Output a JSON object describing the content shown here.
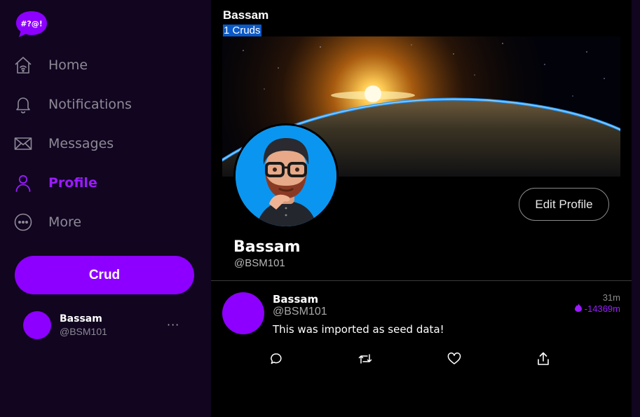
{
  "app": {
    "logo_text": "#?@!",
    "accent": "#8d00ff"
  },
  "sidebar": {
    "items": [
      {
        "label": "Home",
        "icon": "home-icon"
      },
      {
        "label": "Notifications",
        "icon": "bell-icon"
      },
      {
        "label": "Messages",
        "icon": "mail-icon"
      },
      {
        "label": "Profile",
        "icon": "user-icon",
        "active": true
      },
      {
        "label": "More",
        "icon": "more-circle-icon"
      }
    ],
    "crud_button": "Crud",
    "user": {
      "name": "Bassam",
      "handle": "@BSM101",
      "menu": "···"
    }
  },
  "header": {
    "name": "Bassam",
    "count": "1 Cruds"
  },
  "profile": {
    "name": "Bassam",
    "handle": "@BSM101",
    "edit_label": "Edit Profile"
  },
  "post": {
    "name": "Bassam",
    "handle": "@BSM101",
    "time": "31m",
    "score": "-14369m",
    "text": "This was imported as seed data!",
    "actions": [
      "comment-icon",
      "recrud-icon",
      "heart-icon",
      "share-icon"
    ]
  }
}
